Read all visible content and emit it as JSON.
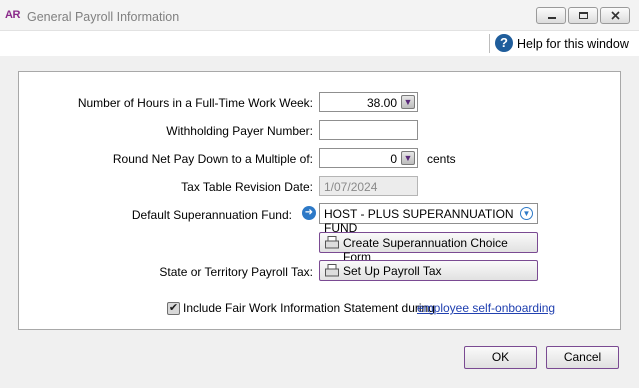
{
  "window": {
    "app_badge": "AR",
    "title": "General Payroll Information",
    "minimize_icon": "minimize-icon",
    "restore_icon": "restore-icon",
    "close_icon": "close-icon"
  },
  "help": {
    "icon_text": "?",
    "label": "Help for this window"
  },
  "form": {
    "hours_label": "Number of Hours in a Full-Time Work Week:",
    "hours_value": "38.00",
    "withholding_label": "Withholding Payer Number:",
    "withholding_value": "",
    "round_label": "Round Net Pay Down to a Multiple of:",
    "round_value": "0",
    "round_unit": "cents",
    "tax_table_label": "Tax Table Revision Date:",
    "tax_table_value": "1/07/2024",
    "super_fund_label": "Default Superannuation Fund:",
    "super_fund_value": "HOST - PLUS SUPERANNUATION FUND",
    "create_super_button": "Create Superannuation Choice Form",
    "payroll_tax_label": "State or Territory Payroll Tax:",
    "payroll_tax_button": "Set Up Payroll Tax",
    "fair_work_label": "Include Fair Work Information Statement during",
    "fair_work_checked": true,
    "fair_work_link": "employee self-onboarding"
  },
  "footer": {
    "ok": "OK",
    "cancel": "Cancel"
  },
  "colors": {
    "accent": "#7a4a92",
    "help_blue": "#1f5d9b",
    "link": "#2040b0",
    "app_badge": "#8a2a8a"
  }
}
